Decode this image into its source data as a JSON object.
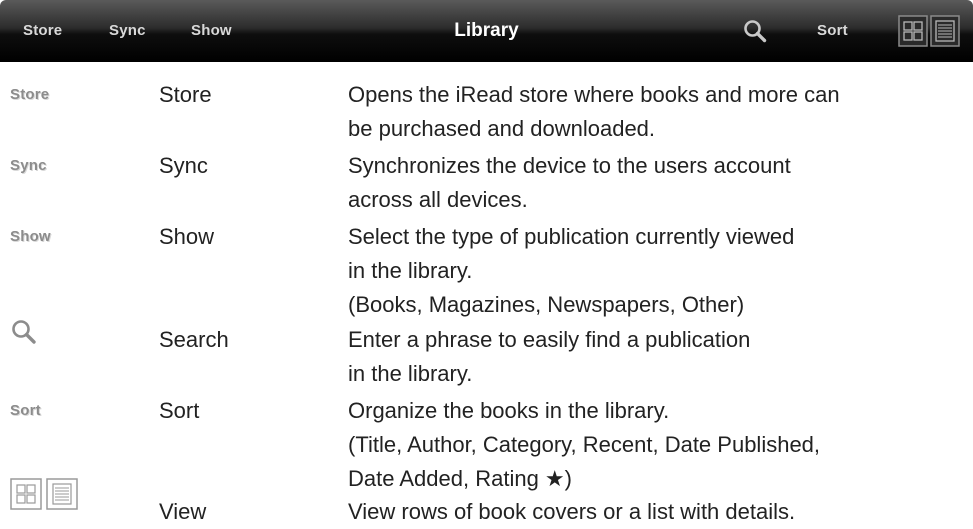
{
  "toolbar": {
    "store_label": "Store",
    "sync_label": "Sync",
    "show_label": "Show",
    "title": "Library",
    "sort_label": "Sort",
    "search_icon": "magnifier-icon",
    "grid_view_icon": "grid-view-icon",
    "list_view_icon": "list-view-icon"
  },
  "legend": [
    {
      "icon_text": "Store",
      "name": "Store",
      "lines": [
        "Opens the iRead store where books and more can",
        "be purchased and downloaded."
      ]
    },
    {
      "icon_text": "Sync",
      "name": "Sync",
      "lines": [
        "Synchronizes the device to the users account",
        "across all devices."
      ]
    },
    {
      "icon_text": "Show",
      "name": "Show",
      "lines": [
        "Select the type of publication currently viewed",
        "in the library.",
        "(Books, Magazines, Newspapers, Other)"
      ]
    },
    {
      "icon": "magnifier-icon",
      "name": "Search",
      "lines": [
        "Enter a phrase to easily find a publication",
        "in the library."
      ]
    },
    {
      "icon_text": "Sort",
      "name": "Sort",
      "lines": [
        "Organize the books in the library.",
        "(Title, Author, Category, Recent, Date Published,",
        "Date Added, Rating ★)"
      ]
    },
    {
      "icon": "grid-and-list-view-icons",
      "name": "View",
      "lines": [
        "View rows of book covers or a list with details."
      ]
    }
  ],
  "colors": {
    "toolbar_top": "#5a5a5a",
    "toolbar_bottom": "#000000",
    "toolbar_text": "#d9d9d9",
    "legend_icon_text": "#8c8c8c",
    "body_text": "#222222"
  }
}
